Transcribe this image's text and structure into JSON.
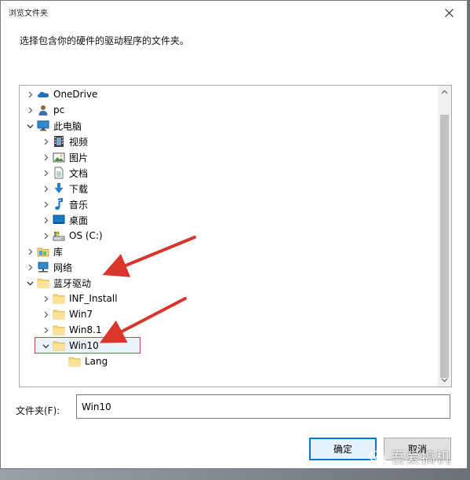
{
  "dialog": {
    "title": "浏览文件夹",
    "instruction": "选择包含你的硬件的驱动程序的文件夹。",
    "close_icon": "close-icon"
  },
  "tree": {
    "items": [
      {
        "label": "OneDrive",
        "icon": "cloud-icon",
        "expander": "chevron-right",
        "indent": 0
      },
      {
        "label": "pc",
        "icon": "user-icon",
        "expander": "chevron-right",
        "indent": 0
      },
      {
        "label": "此电脑",
        "icon": "computer-icon",
        "expander": "chevron-down",
        "indent": 0
      },
      {
        "label": "视频",
        "icon": "video-icon",
        "expander": "chevron-right",
        "indent": 1
      },
      {
        "label": "图片",
        "icon": "pictures-icon",
        "expander": "chevron-right",
        "indent": 1
      },
      {
        "label": "文档",
        "icon": "document-icon",
        "expander": "chevron-right",
        "indent": 1
      },
      {
        "label": "下载",
        "icon": "download-icon",
        "expander": "chevron-right",
        "indent": 1
      },
      {
        "label": "音乐",
        "icon": "music-icon",
        "expander": "chevron-right",
        "indent": 1
      },
      {
        "label": "桌面",
        "icon": "desktop-icon",
        "expander": "chevron-right",
        "indent": 1
      },
      {
        "label": "OS (C:)",
        "icon": "drive-icon",
        "expander": "chevron-right",
        "indent": 1
      },
      {
        "label": "库",
        "icon": "library-icon",
        "expander": "chevron-right",
        "indent": 0
      },
      {
        "label": "网络",
        "icon": "network-icon",
        "expander": "chevron-right",
        "indent": 0
      },
      {
        "label": "蓝牙驱动",
        "icon": "folder-icon",
        "expander": "chevron-down",
        "indent": 0
      },
      {
        "label": "INF_Install",
        "icon": "folder-icon",
        "expander": "chevron-right",
        "indent": 1
      },
      {
        "label": "Win7",
        "icon": "folder-icon",
        "expander": "chevron-right",
        "indent": 1
      },
      {
        "label": "Win8.1",
        "icon": "folder-icon",
        "expander": "chevron-right",
        "indent": 1
      },
      {
        "label": "Win10",
        "icon": "folder-icon",
        "expander": "chevron-down",
        "indent": 1,
        "selected": true
      },
      {
        "label": "Lang",
        "icon": "folder-icon",
        "expander": "none",
        "indent": 2
      }
    ]
  },
  "folder_field": {
    "label": "文件夹(F):",
    "value": "Win10"
  },
  "buttons": {
    "ok": "确定",
    "cancel": "取消"
  },
  "watermark": {
    "text": "吾爱搞机",
    "icon": "wechat-icon"
  },
  "colors": {
    "selection_border": "#d0463b",
    "annotation_arrow": "#d9352b",
    "primary_button_border": "#0078d7",
    "folder_yellow": "#f8d775"
  }
}
